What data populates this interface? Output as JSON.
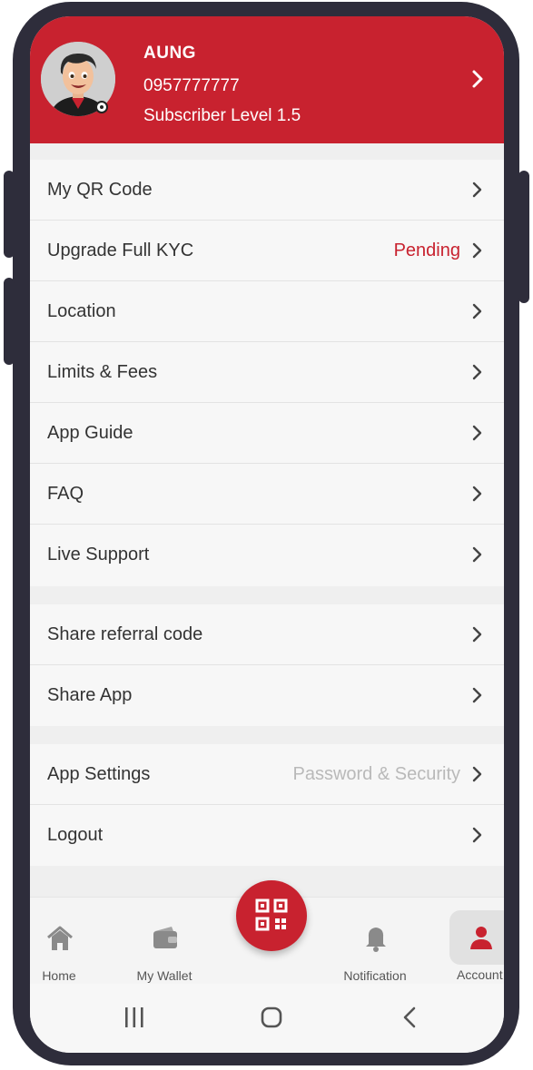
{
  "profile": {
    "name": "AUNG",
    "phone": "0957777777",
    "level": "Subscriber Level 1.5"
  },
  "menu_group_1": [
    {
      "label": "My QR Code",
      "value": ""
    },
    {
      "label": "Upgrade Full KYC",
      "value": "Pending"
    },
    {
      "label": "Location",
      "value": ""
    },
    {
      "label": "Limits & Fees",
      "value": ""
    },
    {
      "label": "App Guide",
      "value": ""
    },
    {
      "label": "FAQ",
      "value": ""
    },
    {
      "label": "Live Support",
      "value": ""
    }
  ],
  "menu_group_2": [
    {
      "label": "Share referral code",
      "value": ""
    },
    {
      "label": "Share App",
      "value": ""
    }
  ],
  "menu_group_3": [
    {
      "label": "App Settings",
      "value": "Password & Security"
    },
    {
      "label": "Logout",
      "value": ""
    }
  ],
  "bottom_nav": [
    {
      "label": "Home",
      "icon": "home-icon"
    },
    {
      "label": "My Wallet",
      "icon": "wallet-icon"
    },
    {
      "label": "",
      "icon": "qr-scan-icon"
    },
    {
      "label": "Notification",
      "icon": "bell-icon"
    },
    {
      "label": "Account",
      "icon": "account-icon"
    }
  ],
  "system_nav": {
    "recents_icon": "recents-icon",
    "home_icon": "circle-home-icon",
    "back_icon": "back-icon"
  },
  "colors": {
    "brand_red": "#c8222f",
    "pending": "#c8222f",
    "muted_value": "#b9b9b9",
    "background": "#efefef"
  }
}
